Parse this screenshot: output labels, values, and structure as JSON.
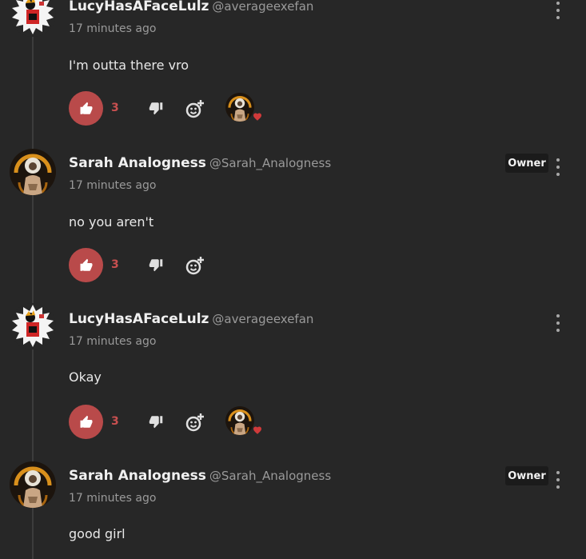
{
  "comments": [
    {
      "author": "LucyHasAFaceLulz",
      "handle": "@averageexefan",
      "time": "17 minutes ago",
      "text": "I'm outta there vro",
      "likes": "3",
      "owner": "",
      "has_reaction": true
    },
    {
      "author": "Sarah Analogness",
      "handle": "@Sarah_Analogness",
      "time": "17 minutes ago",
      "text": "no you aren't",
      "likes": "3",
      "owner": "Owner",
      "has_reaction": false
    },
    {
      "author": "LucyHasAFaceLulz",
      "handle": "@averageexefan",
      "time": "17 minutes ago",
      "text": "Okay",
      "likes": "3",
      "owner": "",
      "has_reaction": true
    },
    {
      "author": "Sarah Analogness",
      "handle": "@Sarah_Analogness",
      "time": "17 minutes ago",
      "text": "good girl",
      "likes": "",
      "owner": "Owner",
      "has_reaction": false
    }
  ],
  "icons": {
    "like": "thumbs-up-icon",
    "dislike": "thumbs-down-icon",
    "react": "add-reaction-icon",
    "menu": "kebab-menu-icon",
    "heart": "heart-icon"
  },
  "colors": {
    "accent": "#b94a4a",
    "like_count": "#c85050",
    "background": "#272727",
    "badge": "#1b1b1b"
  }
}
